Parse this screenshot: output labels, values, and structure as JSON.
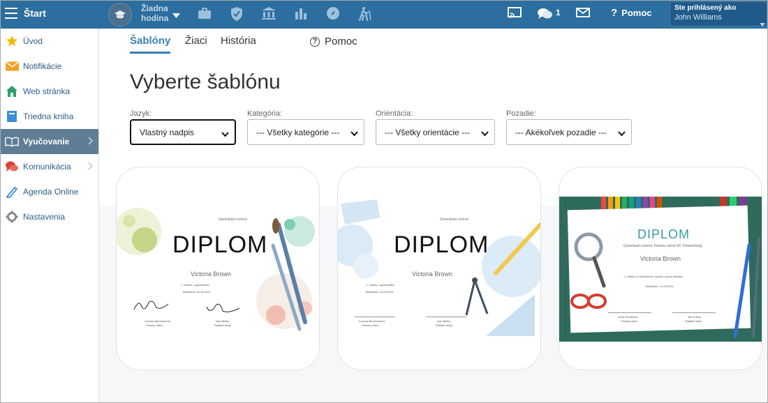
{
  "topbar": {
    "start_label": "Štart",
    "lesson_line1": "Žiadna",
    "lesson_line2": "hodina",
    "messages_count": "1",
    "help_label": "Pomoc",
    "user_line1": "Ste prihlásený ako",
    "user_name": "John Williams"
  },
  "sidebar": {
    "items": [
      {
        "label": "Úvod",
        "icon": "star-icon"
      },
      {
        "label": "Notifikácie",
        "icon": "envelope-icon"
      },
      {
        "label": "Web stránka",
        "icon": "house-icon"
      },
      {
        "label": "Triedna kniha",
        "icon": "book-icon"
      },
      {
        "label": "Vyučovanie",
        "icon": "open-book-icon"
      },
      {
        "label": "Komunikácia",
        "icon": "chat-icon"
      },
      {
        "label": "Agenda Online",
        "icon": "pencil-icon"
      },
      {
        "label": "Nastavenia",
        "icon": "gear-icon"
      }
    ]
  },
  "tabs": {
    "templates": "Šablóny",
    "students": "Žiaci",
    "history": "História",
    "help": "Pomoc"
  },
  "heading": "Vyberte šablónu",
  "filters": {
    "language": {
      "label": "Jazyk:",
      "value": "Vlastný nadpis"
    },
    "category": {
      "label": "Kategória:",
      "value": "--- Všetky kategórie ---"
    },
    "orientation": {
      "label": "Orientácia:",
      "value": "--- Všetky orientácie ---"
    },
    "background": {
      "label": "Pozadie:",
      "value": "--- Akékoľvek pozadie ---"
    }
  },
  "cards": [
    {
      "school": "Greenlearn school",
      "title": "DIPLOM",
      "name": "Victoria Brown",
      "line1": "1. miesto v gymnastike",
      "place": "Bratislava, 15.06.2021",
      "sig1_name": "Zuzana Bunkovičová",
      "sig1_role": "Triedny učiteľ",
      "sig2_name": "Ivan Bielko",
      "sig2_role": "Riaditeľ školy"
    },
    {
      "school": "Greenlearn school",
      "title": "DIPLOM",
      "name": "Victoria Brown",
      "line1": "1. miesto v gymnastike",
      "place": "Bratislava, 15.06.2021",
      "sig1_name": "Zuzana Bunkovičová",
      "sig1_role": "Triedny učiteľ",
      "sig2_name": "Ivan Bielko",
      "sig2_role": "Riaditeľ školy"
    },
    {
      "school": "Greenlearn school, Flowers street 42, Flowersburg",
      "title": "DIPLOM",
      "name": "Victoria Brown",
      "line1": "1. miesto vo florbalovom turnaji o pohár starostu",
      "place": "Bratislava, 14.06.2021",
      "sig1_name": "Anna Nováková",
      "sig1_role": "Triedny učiteľ",
      "sig2_name": "Ján Hubný",
      "sig2_role": "Riaditeľ školy"
    }
  ],
  "colors": {
    "topbar": "#2c6e9f",
    "accent": "#3a7fb5",
    "sidebar_active": "#5f7e96",
    "band": "#f6f7f9"
  }
}
